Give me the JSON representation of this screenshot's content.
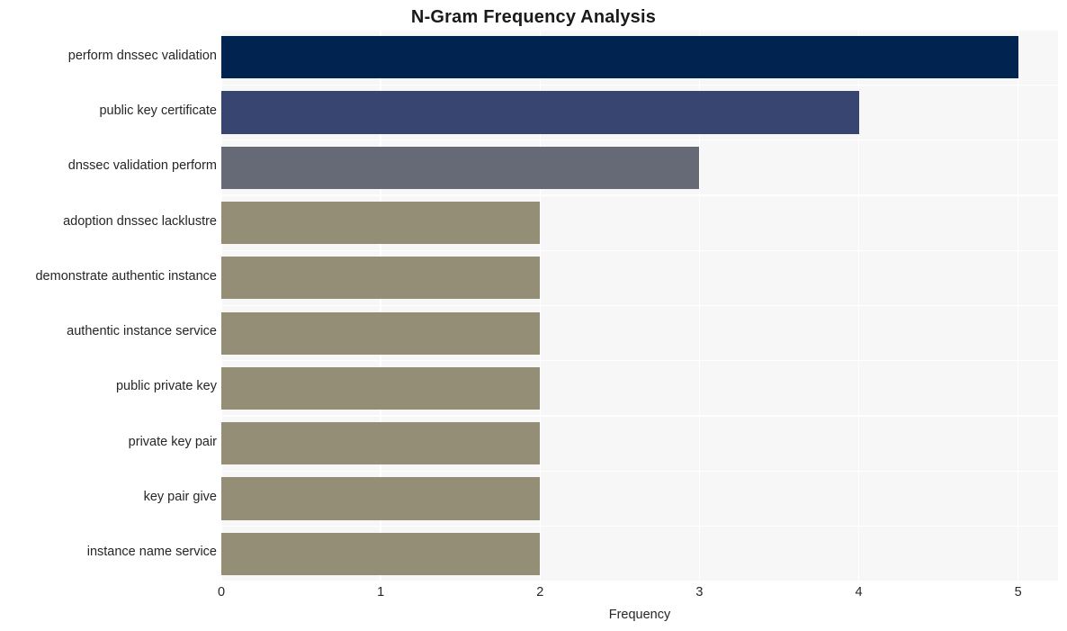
{
  "chart_data": {
    "type": "bar",
    "orientation": "horizontal",
    "title": "N-Gram Frequency Analysis",
    "xlabel": "Frequency",
    "ylabel": "",
    "categories": [
      "perform dnssec validation",
      "public key certificate",
      "dnssec validation perform",
      "adoption dnssec lacklustre",
      "demonstrate authentic instance",
      "authentic instance service",
      "public private key",
      "private key pair",
      "key pair give",
      "instance name service"
    ],
    "values": [
      5,
      4,
      3,
      2,
      2,
      2,
      2,
      2,
      2,
      2
    ],
    "bar_colors": [
      "#00244f",
      "#374570",
      "#666a76",
      "#948e76",
      "#948e76",
      "#948e76",
      "#948e76",
      "#948e76",
      "#948e76",
      "#948e76"
    ],
    "xlim": [
      0,
      5.25
    ],
    "xticks": [
      0,
      1,
      2,
      3,
      4,
      5
    ],
    "xtick_labels": [
      "0",
      "1",
      "2",
      "3",
      "4",
      "5"
    ],
    "grid": true,
    "grid_color": "#ffffff",
    "plot_background": "#f7f7f7",
    "figure_background": "#ffffff",
    "legend": null,
    "legend_position": "none"
  },
  "style": {
    "title_color": "#1a1a1a",
    "tick_color": "#262626"
  }
}
